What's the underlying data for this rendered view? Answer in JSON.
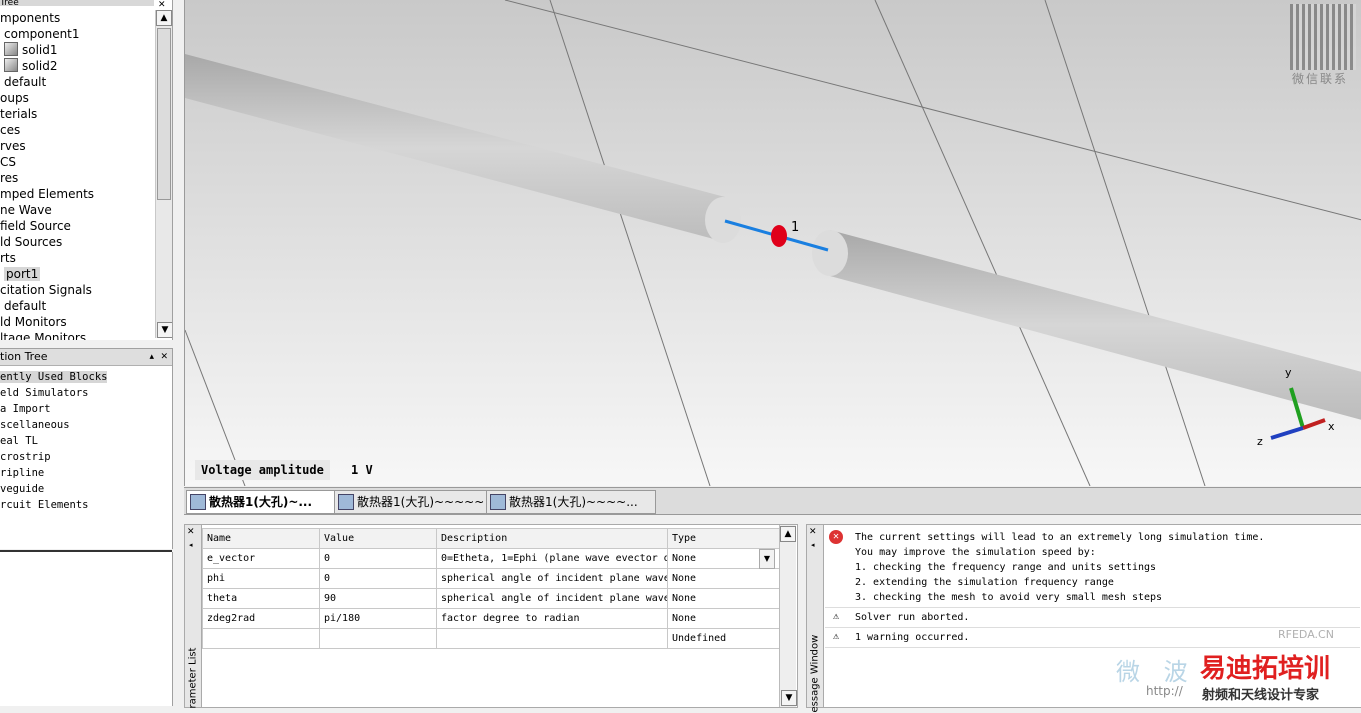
{
  "navigation_tree": {
    "header": "Tree",
    "items": [
      {
        "label": "mponents",
        "indent": 0
      },
      {
        "label": "component1",
        "indent": 1
      },
      {
        "label": "solid1",
        "indent": 2,
        "icon": "cube-icon"
      },
      {
        "label": "solid2",
        "indent": 2,
        "icon": "cube-icon"
      },
      {
        "label": "default",
        "indent": 1
      },
      {
        "label": "oups",
        "indent": 0
      },
      {
        "label": "terials",
        "indent": 0
      },
      {
        "label": "ces",
        "indent": 0
      },
      {
        "label": "rves",
        "indent": 0
      },
      {
        "label": "CS",
        "indent": 0
      },
      {
        "label": "res",
        "indent": 0
      },
      {
        "label": "mped Elements",
        "indent": 0
      },
      {
        "label": "ne Wave",
        "indent": 0
      },
      {
        "label": "field Source",
        "indent": 0
      },
      {
        "label": "ld Sources",
        "indent": 0
      },
      {
        "label": "rts",
        "indent": 0
      },
      {
        "label": "port1",
        "indent": 1,
        "selected": true
      },
      {
        "label": "citation Signals",
        "indent": 0
      },
      {
        "label": "default",
        "indent": 1
      },
      {
        "label": "ld Monitors",
        "indent": 0
      },
      {
        "label": "ltage Monitors",
        "indent": 0
      }
    ]
  },
  "components_tree": {
    "header": "tion Tree",
    "items": [
      {
        "label": "ently Used Blocks",
        "selected": true
      },
      {
        "label": "eld Simulators"
      },
      {
        "label": "a Import"
      },
      {
        "label": "scellaneous"
      },
      {
        "label": "eal TL"
      },
      {
        "label": "crostrip"
      },
      {
        "label": "ripline"
      },
      {
        "label": "veguide"
      },
      {
        "label": "rcuit Elements"
      }
    ]
  },
  "viewport": {
    "port_label": "1",
    "amplitude_label": "Voltage amplitude",
    "amplitude_value": "1 V",
    "axes": {
      "x": "x",
      "y": "y",
      "z": "z"
    }
  },
  "tabs": [
    {
      "label": "散热器1(大孔)~...",
      "active": true
    },
    {
      "label": "散热器1(大孔)~~~~~",
      "active": false
    },
    {
      "label": "散热器1(大孔)~~~~...",
      "active": false
    }
  ],
  "parameter_list": {
    "panel_label": "rameter List",
    "columns": [
      "Name",
      "Value",
      "Description",
      "Type"
    ],
    "rows": [
      [
        "e_vector",
        "0",
        "0=Etheta, 1=Ephi (plane wave evector d",
        "None"
      ],
      [
        "phi",
        "0",
        "spherical angle of incident plane wave",
        "None"
      ],
      [
        "theta",
        "90",
        "spherical angle of incident plane wave",
        "None"
      ],
      [
        "zdeg2rad",
        "pi/180",
        "factor degree to radian",
        "None"
      ],
      [
        "",
        "",
        "",
        "Undefined"
      ]
    ]
  },
  "message_window": {
    "panel_label": "essage Window",
    "messages": [
      {
        "level": "error",
        "lines": [
          "The current settings will lead to an extremely long simulation time.",
          "You may improve the simulation speed by:",
          "1. checking the frequency range and units settings",
          "2. extending the simulation frequency range",
          "3. checking the mesh to avoid very small mesh steps"
        ]
      },
      {
        "level": "warning",
        "lines": [
          "Solver run aborted."
        ]
      },
      {
        "level": "warning",
        "lines": [
          "1 warning occurred."
        ]
      }
    ]
  },
  "watermark": {
    "qr_label": "微信联系",
    "brand": "易迪拓培训",
    "tagline": "射频和天线设计专家",
    "domain": "RFEDA.CN",
    "url_prefix": "http://",
    "faint_text": "微 波"
  },
  "colors": {
    "port_marker": "#e0001a",
    "port_line": "#1a7fe0",
    "cylinder": "#c4c4c4",
    "axis_x": "#c02020",
    "axis_y": "#20a020",
    "axis_z": "#2040c0",
    "watermark_brand": "#e02020"
  }
}
